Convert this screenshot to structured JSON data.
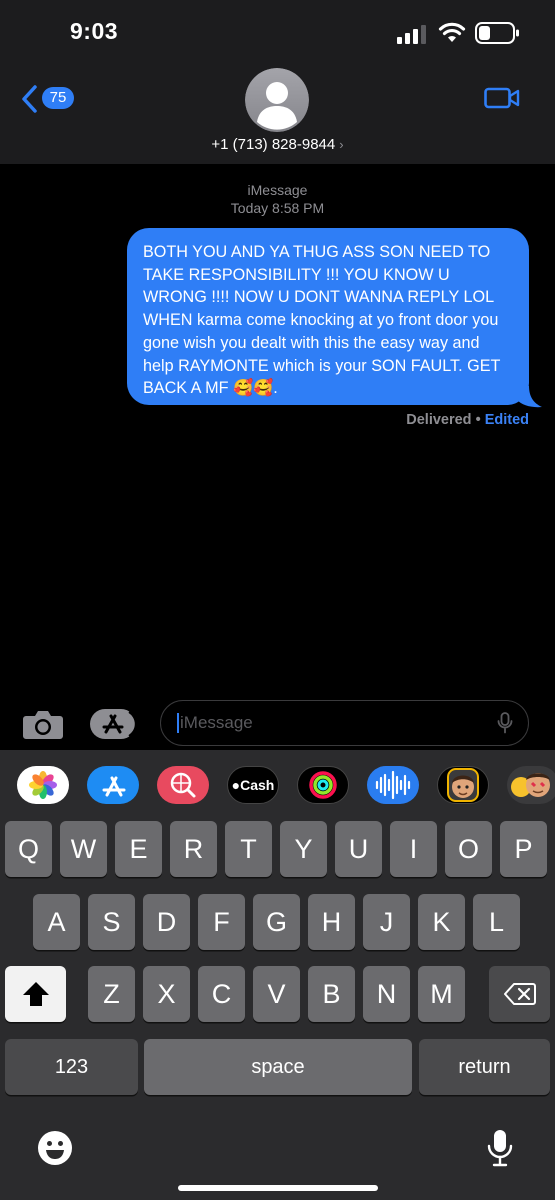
{
  "status_bar": {
    "time": "9:03"
  },
  "header": {
    "back_badge": "75",
    "contact": "+1 (713) 828-9844",
    "contact_chevron": "›"
  },
  "conversation": {
    "service": "iMessage",
    "timestamp": "Today 8:58 PM",
    "message": "BOTH YOU AND YA THUG ASS SON NEED TO TAKE RESPONSIBILITY !!! YOU KNOW U WRONG !!!! NOW U DONT WANNA REPLY LOL WHEN karma come knocking at yo front door you gone wish you dealt with this the easy way and help RAYMONTE which is your SON FAULT. GET BACK A MF 🥰🥰.",
    "status": "Delivered",
    "status_sep": " • ",
    "edited": "Edited"
  },
  "input": {
    "placeholder": "iMessage"
  },
  "app_strip": [
    {
      "name": "photos-icon"
    },
    {
      "name": "app-store-icon"
    },
    {
      "name": "images-search-icon"
    },
    {
      "name": "apple-cash-icon",
      "label": "Cash"
    },
    {
      "name": "activity-icon"
    },
    {
      "name": "audio-message-icon"
    },
    {
      "name": "memoji-icon"
    },
    {
      "name": "memoji-stickers-icon"
    }
  ],
  "keyboard": {
    "row1": [
      "Q",
      "W",
      "E",
      "R",
      "T",
      "Y",
      "U",
      "I",
      "O",
      "P"
    ],
    "row2": [
      "A",
      "S",
      "D",
      "F",
      "G",
      "H",
      "J",
      "K",
      "L"
    ],
    "row3": [
      "Z",
      "X",
      "C",
      "V",
      "B",
      "N",
      "M"
    ],
    "numbers": "123",
    "space": "space",
    "return": "return"
  },
  "colors": {
    "accent": "#2f7ef6",
    "bubble": "#2f7ef6",
    "bar": "#1c1c1e",
    "keyboard": "#2b2b2d"
  }
}
